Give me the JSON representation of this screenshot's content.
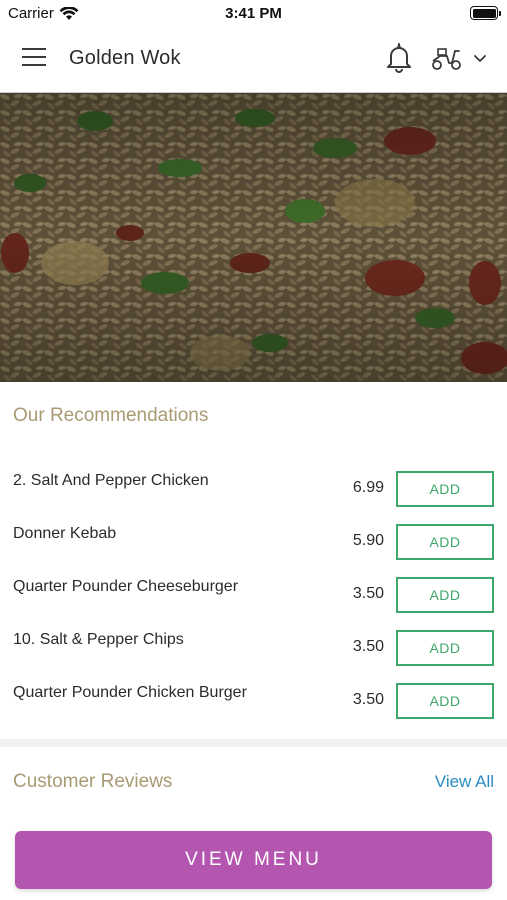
{
  "status_bar": {
    "carrier": "Carrier",
    "time": "3:41 PM"
  },
  "header": {
    "title": "Golden Wok"
  },
  "recommendations": {
    "title": "Our Recommendations",
    "items": [
      {
        "name": "2. Salt And Pepper Chicken",
        "price": "6.99",
        "action": "ADD"
      },
      {
        "name": "Donner Kebab",
        "price": "5.90",
        "action": "ADD"
      },
      {
        "name": "Quarter Pounder Cheeseburger",
        "price": "3.50",
        "action": "ADD"
      },
      {
        "name": "10. Salt & Pepper Chips",
        "price": "3.50",
        "action": "ADD"
      },
      {
        "name": "Quarter Pounder Chicken Burger",
        "price": "3.50",
        "action": "ADD"
      }
    ]
  },
  "reviews": {
    "title": "Customer Reviews",
    "view_all": "View All"
  },
  "footer": {
    "view_menu": "VIEW MENU"
  },
  "colors": {
    "accent_gold": "#a89a72",
    "add_green": "#3fa66b",
    "link_blue": "#2a8cc4",
    "menu_purple": "#b456b0"
  }
}
